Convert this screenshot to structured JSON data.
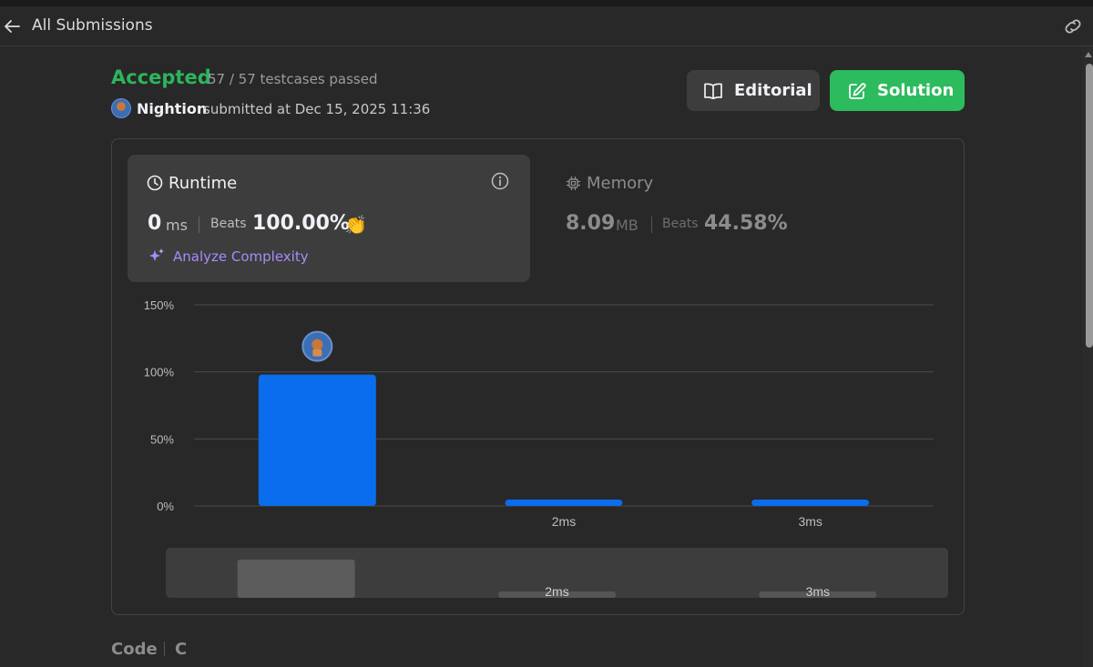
{
  "header": {
    "back_label": "All Submissions"
  },
  "submission": {
    "status": "Accepted",
    "testcases": "57 / 57 testcases passed",
    "username": "Nightion",
    "submitted_text": "submitted at Dec 15, 2025 11:36"
  },
  "buttons": {
    "editorial": "Editorial",
    "solution": "Solution"
  },
  "runtime": {
    "title": "Runtime",
    "value": "0",
    "unit": "ms",
    "beats_label": "Beats",
    "beats_value": "100.00%",
    "analyze_label": "Analyze Complexity"
  },
  "memory": {
    "title": "Memory",
    "value": "8.09",
    "unit": "MB",
    "beats_label": "Beats",
    "beats_value": "44.58%"
  },
  "chart_data": {
    "type": "bar",
    "categories": [
      "",
      "2ms",
      "3ms"
    ],
    "values": [
      98,
      4,
      4
    ],
    "ylim": [
      0,
      150
    ],
    "yticks": [
      "0%",
      "50%",
      "100%",
      "150%"
    ],
    "highlighted_index": 0,
    "grid": true,
    "colors": {
      "bar": "#0a6ded",
      "grid": "#4a4a4a",
      "overview_active": "#5c5c5c",
      "overview_inactive": "#555555",
      "overview_bg": "#3d3d3d"
    }
  },
  "code": {
    "label": "Code",
    "language": "C"
  },
  "colors": {
    "accepted": "#2db55d",
    "solution_button": "#2cbb5d",
    "analyze_link": "#a78bfa"
  }
}
